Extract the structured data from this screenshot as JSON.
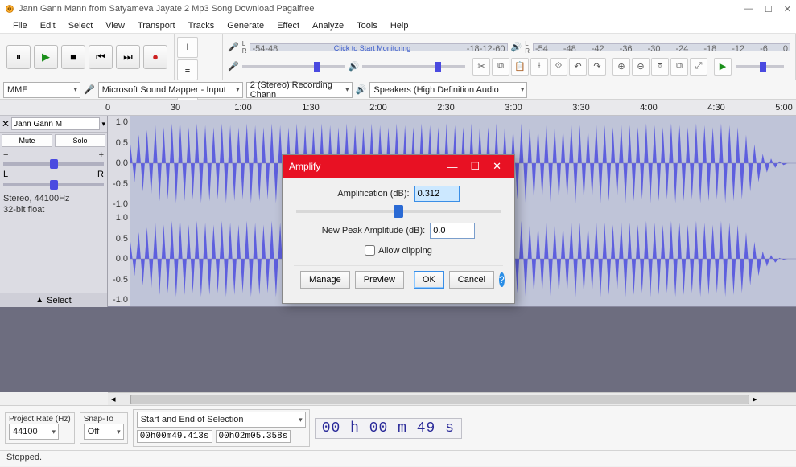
{
  "window": {
    "title": "Jann Gann Mann from Satyameva Jayate 2 Mp3 Song Download Pagalfree"
  },
  "menu": [
    "File",
    "Edit",
    "Select",
    "View",
    "Transport",
    "Tracks",
    "Generate",
    "Effect",
    "Analyze",
    "Tools",
    "Help"
  ],
  "meter": {
    "rec_prompt": "Click to Start Monitoring",
    "ticks": [
      "-54",
      "-48",
      "-42",
      "-36",
      "-30",
      "-24",
      "-18",
      "-12",
      "-6",
      "0"
    ]
  },
  "devices": {
    "host": "MME",
    "input": "Microsoft Sound Mapper - Input",
    "channels": "2 (Stereo) Recording Chann",
    "output": "Speakers (High Definition Audio"
  },
  "timeline": [
    "0",
    "30",
    "1:00",
    "1:30",
    "2:00",
    "2:30",
    "3:00",
    "3:30",
    "4:00",
    "4:30",
    "5:00"
  ],
  "track": {
    "name": "Jann Gann M",
    "mute": "Mute",
    "solo": "Solo",
    "l": "L",
    "r": "R",
    "info1": "Stereo, 44100Hz",
    "info2": "32-bit float",
    "scale": [
      "1.0",
      "0.5",
      "0.0",
      "-0.5",
      "-1.0"
    ],
    "select": "Select"
  },
  "dialog": {
    "title": "Amplify",
    "amp_label": "Amplification (dB):",
    "amp_value": "0.312",
    "peak_label": "New Peak Amplitude (dB):",
    "peak_value": "0.0",
    "allow": "Allow clipping",
    "manage": "Manage",
    "preview": "Preview",
    "ok": "OK",
    "cancel": "Cancel"
  },
  "footer": {
    "rate_label": "Project Rate (Hz)",
    "rate": "44100",
    "snap_label": "Snap-To",
    "snap": "Off",
    "sel_label": "Start and End of Selection",
    "sel_start": "00h00m49.413s",
    "sel_end": "00h02m05.358s",
    "bigtime": "00 h 00 m 49 s",
    "status": "Stopped."
  }
}
